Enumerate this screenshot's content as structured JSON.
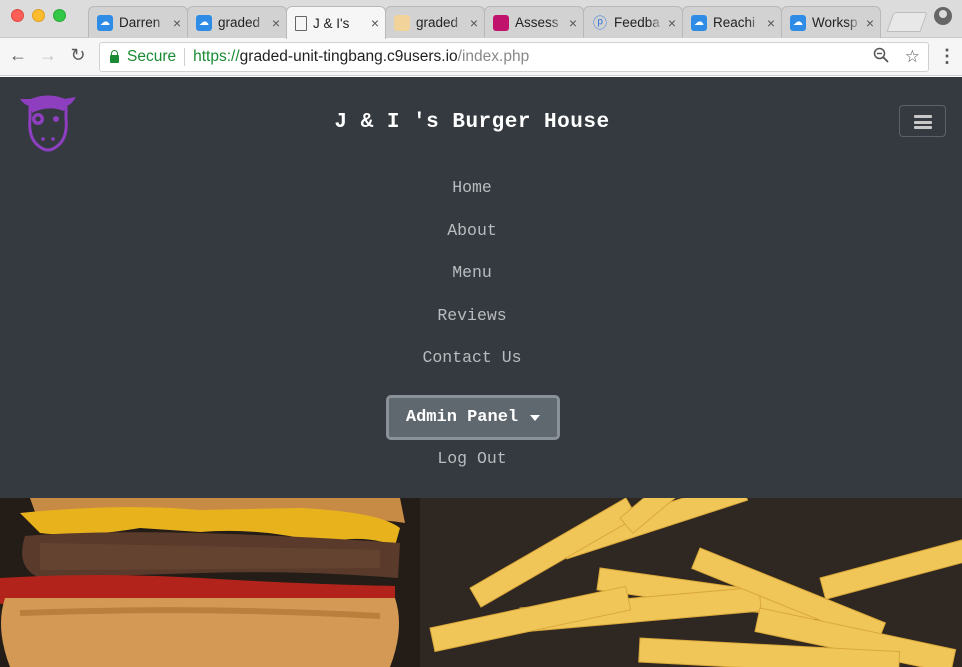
{
  "browser": {
    "tabs": [
      {
        "title": "Darren",
        "favicon": "cloud9-icon"
      },
      {
        "title": "graded",
        "favicon": "cloud9-icon"
      },
      {
        "title": "J & I's",
        "favicon": "document-icon",
        "active": true
      },
      {
        "title": "graded",
        "favicon": "pizza-icon"
      },
      {
        "title": "Assess",
        "favicon": "assessment-icon"
      },
      {
        "title": "Feedba",
        "favicon": "feedback-icon"
      },
      {
        "title": "Reachi",
        "favicon": "cloud9-icon"
      },
      {
        "title": "Worksp",
        "favicon": "cloud9-icon"
      }
    ],
    "tab_close_glyph": "×",
    "secure_label": "Secure",
    "url": {
      "scheme": "https://",
      "host": "graded-unit-tingbang.c9users.io",
      "path": "/index.php"
    },
    "colors": {
      "secure": "#1a8a33",
      "tabstrip": "#dcdcdc"
    }
  },
  "site": {
    "brand": "J & I 's Burger House",
    "logo_icon": "cow-logo-icon",
    "nav_links": [
      "Home",
      "About",
      "Menu",
      "Reviews",
      "Contact Us"
    ],
    "admin_button": "Admin Panel",
    "logout": "Log Out",
    "hero_image": "burger-and-fries-photo",
    "colors": {
      "navbar": "#343a40",
      "logo": "#8e3fbf",
      "admin_button": "#5f676f"
    }
  }
}
